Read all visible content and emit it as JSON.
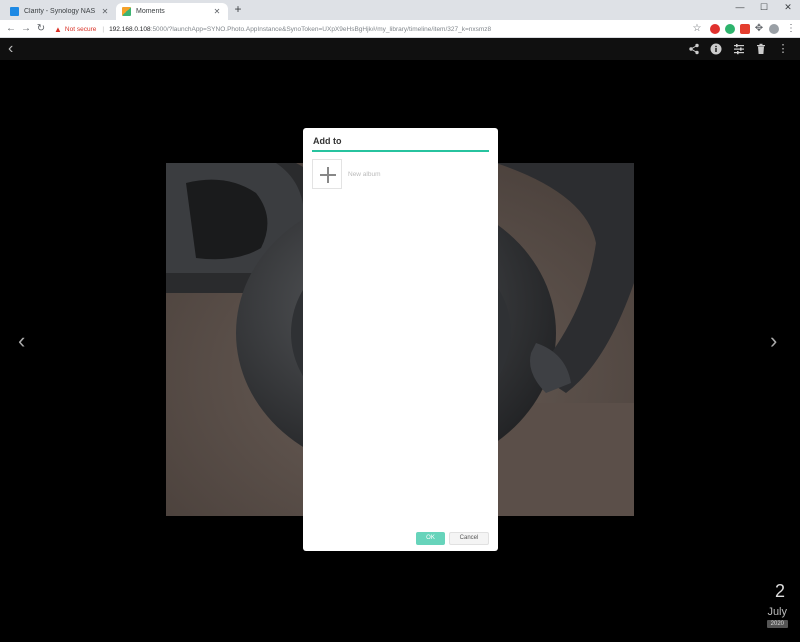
{
  "browser": {
    "tabs": [
      {
        "label": "Clarity - Synology NAS",
        "favicon_color": "#1d89e4",
        "active": false
      },
      {
        "label": "Moments",
        "favicon_color": "#f4a12a",
        "active": true
      }
    ],
    "new_tab": "+",
    "window_controls": [
      "—",
      "☐",
      "✕"
    ],
    "address": {
      "warning": "Not secure",
      "host": "192.168.0.108",
      "rest": ":5000/?launchApp=SYNO.Photo.AppInstance&SynoToken=UXpX9eHsBgHjk#/my_library/timeline/item/327_k=nxsmz8"
    }
  },
  "viewer": {
    "date": {
      "day": "2",
      "month": "July",
      "year": "2020"
    }
  },
  "dialog": {
    "title": "Add to",
    "new_album_label": "New album",
    "ok_label": "OK",
    "cancel_label": "Cancel",
    "accent": "#27c39f"
  }
}
